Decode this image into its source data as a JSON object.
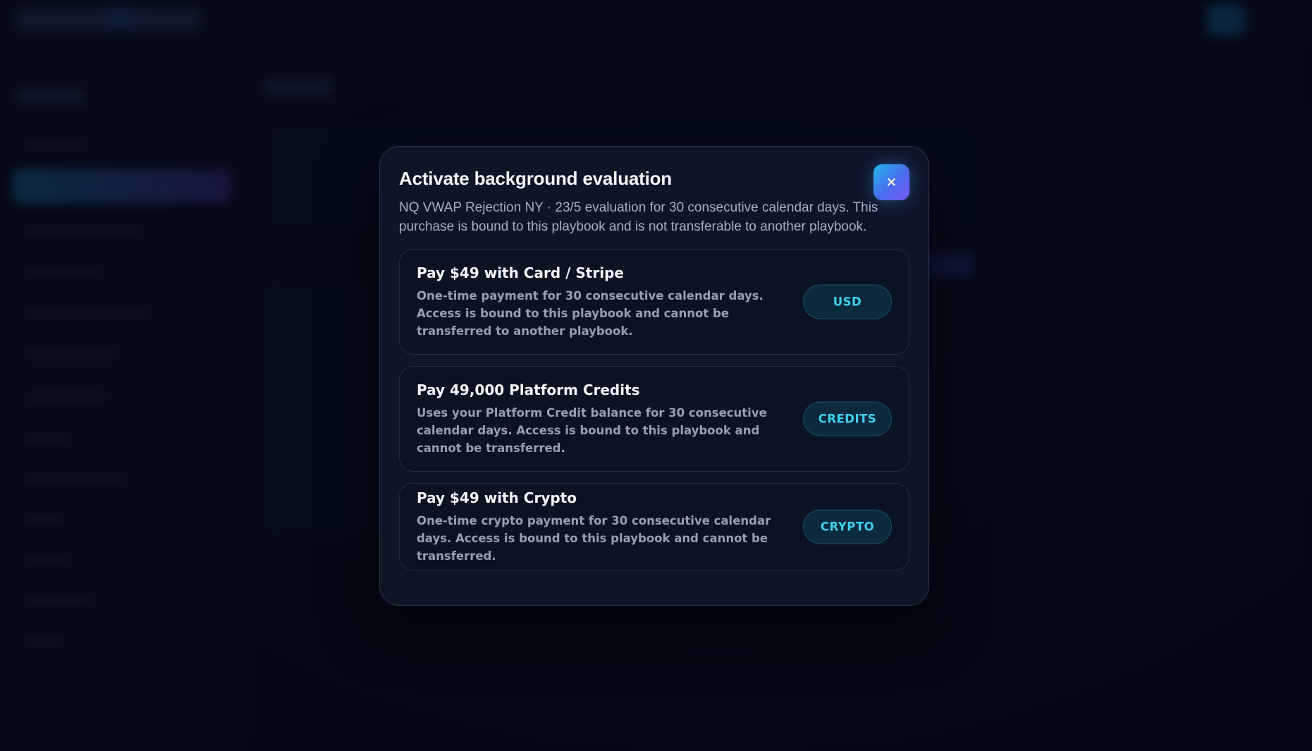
{
  "modal": {
    "title": "Activate background evaluation",
    "description": "NQ VWAP Rejection NY · 23/5 evaluation for 30 consecutive calendar days. This purchase is bound to this playbook and is not transferable to another playbook.",
    "close_label": "×",
    "close_icon": "close-icon"
  },
  "options": [
    {
      "title": "Pay $49 with Card / Stripe",
      "description": "One-time payment for 30 consecutive calendar days. Access is bound to this playbook and cannot be transferred to another playbook.",
      "badge": "USD"
    },
    {
      "title": "Pay 49,000 Platform Credits",
      "description": "Uses your Platform Credit balance for 30 consecutive calendar days. Access is bound to this playbook and cannot be transferred.",
      "badge": "CREDITS"
    },
    {
      "title": "Pay $49 with Crypto",
      "description": "One-time crypto payment for 30 consecutive calendar days. Access is bound to this playbook and cannot be transferred.",
      "badge": "CRYPTO"
    }
  ],
  "colors": {
    "modal_bg": "#0e1527",
    "accent_cyan": "#3fd0f0",
    "close_gradient_start": "#22b7e8",
    "close_gradient_end": "#7a55ee",
    "badge_bg": "#0c2a3e"
  }
}
